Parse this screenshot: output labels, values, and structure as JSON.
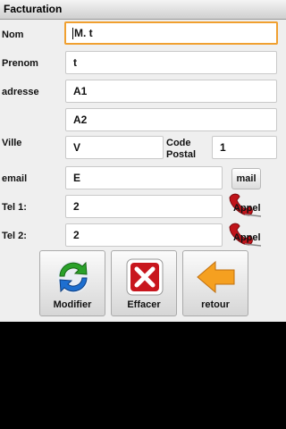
{
  "app": {
    "title": "Facturation"
  },
  "form": {
    "nom": {
      "label": "Nom",
      "value": "M. t"
    },
    "prenom": {
      "label": "Prenom",
      "value": "t"
    },
    "adresse": {
      "label": "adresse",
      "value1": "A1",
      "value2": "A2"
    },
    "ville": {
      "label": "Ville",
      "value": "V"
    },
    "code_postal": {
      "label_line1": "Code",
      "label_line2": "Postal",
      "value": "1"
    },
    "email": {
      "label": "email",
      "value": "E",
      "button": "mail"
    },
    "tel1": {
      "label": "Tel 1:",
      "value": "2",
      "button": "Appel"
    },
    "tel2": {
      "label": "Tel 2:",
      "value": "2",
      "button": "Appel"
    }
  },
  "actions": {
    "modifier": "Modifier",
    "effacer": "Effacer",
    "retour": "retour"
  },
  "icons": {
    "modifier": "sync-arrows-icon",
    "effacer": "red-x-icon",
    "retour": "arrow-left-icon",
    "appel": "phone-icon"
  },
  "colors": {
    "focus": "#f0a030",
    "background": "#efefef",
    "delete": "#c8161d",
    "back_arrow": "#f5a020"
  }
}
